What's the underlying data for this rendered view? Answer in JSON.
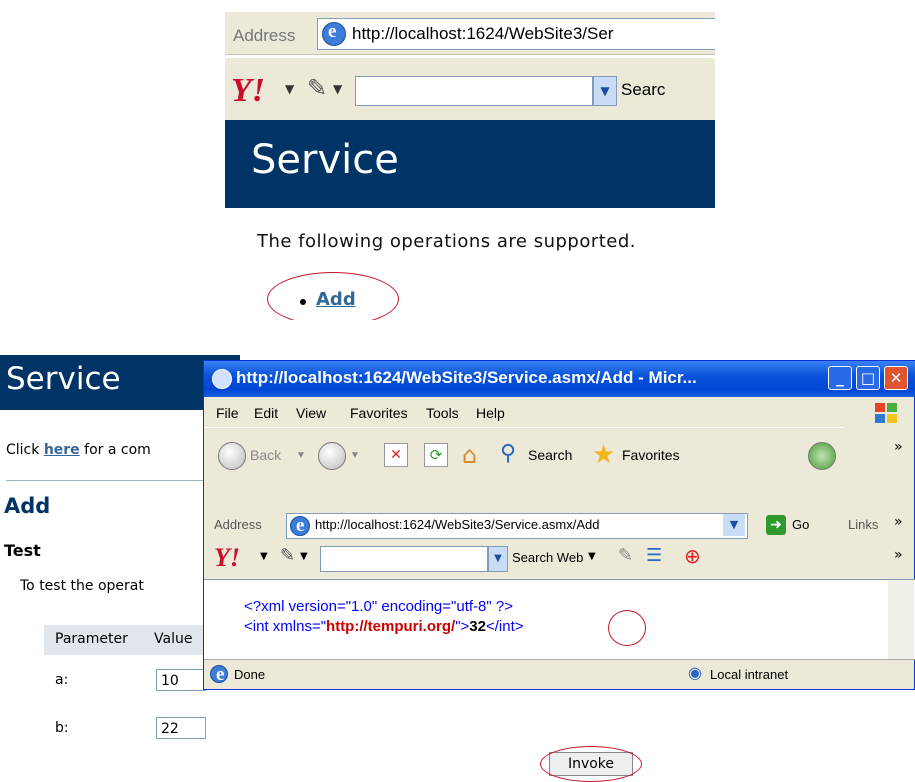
{
  "top": {
    "address_label": "Address",
    "url": "http://localhost:1624/WebSite3/Ser",
    "yahoo_logo": "Y!",
    "search_label": "Searc",
    "header_title": "Service",
    "ops_text": "The following operations are supported.",
    "ops": [
      {
        "label": "Add"
      }
    ]
  },
  "page": {
    "title": "Service",
    "click_prefix": "Click ",
    "click_link": "here",
    "click_suffix": " for a com",
    "op_heading": "Add",
    "test_heading": "Test",
    "to_test": "To test the operat",
    "table": {
      "headers": [
        "Parameter",
        "Value"
      ],
      "rows": [
        {
          "param": "a:",
          "value": "10"
        },
        {
          "param": "b:",
          "value": "22"
        }
      ]
    },
    "invoke_label": "Invoke"
  },
  "popup": {
    "title": "http://localhost:1624/WebSite3/Service.asmx/Add - Micr...",
    "menu": [
      "File",
      "Edit",
      "View",
      "Favorites",
      "Tools",
      "Help"
    ],
    "toolbar": {
      "back": "Back",
      "search": "Search",
      "favorites": "Favorites"
    },
    "address_label": "Address",
    "url": "http://localhost:1624/WebSite3/Service.asmx/Add",
    "go_label": "Go",
    "links_label": "Links",
    "more": "»",
    "yahoo_logo": "Y!",
    "search_web": "Search Web",
    "xml_decl": "<?xml version=\"1.0\" encoding=\"utf-8\" ?>",
    "xml_open": "<int xmlns=\"",
    "xml_ns": "http://tempuri.org/",
    "xml_close_quote": "\">",
    "xml_value": "32",
    "xml_end": "</int>",
    "status_left": "Done",
    "status_zone": "Local intranet"
  },
  "colors": {
    "header_blue": "#003366",
    "link_blue": "#336699",
    "highlight_red": "#c8142e"
  }
}
